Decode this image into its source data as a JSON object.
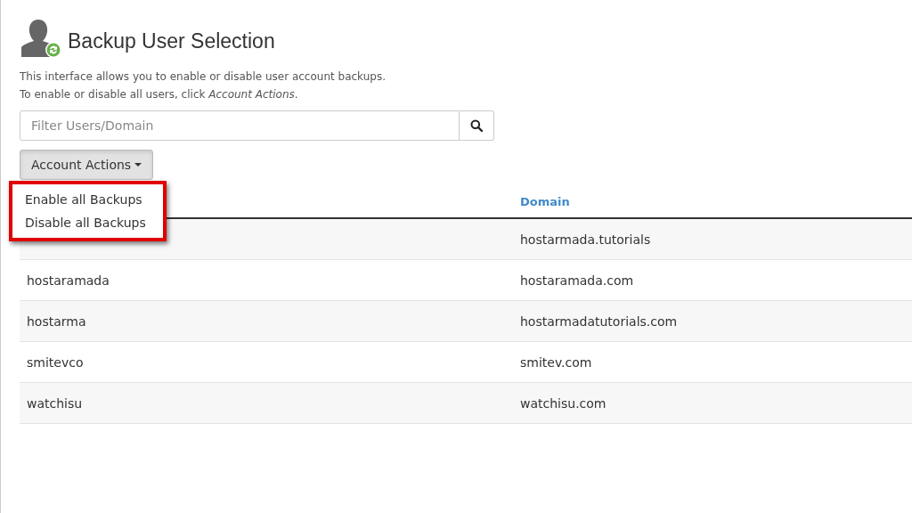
{
  "page": {
    "title": "Backup User Selection",
    "description": [
      "This interface allows you to enable or disable user account backups.",
      "To enable or disable all users, click *Account Actions*."
    ]
  },
  "filter": {
    "placeholder": "Filter Users/Domain"
  },
  "actions_button": {
    "label": "Account Actions",
    "expanded": true
  },
  "actions_menu": {
    "highlighted": true,
    "items": [
      "Enable all Backups",
      "Disable all Backups"
    ]
  },
  "table": {
    "columns": [
      "Domain"
    ],
    "rows": [
      {
        "domain": "hostarmada.tutorials"
      },
      {
        "user": "hostaramada",
        "domain": "hostaramada.com"
      },
      {
        "user": "hostarma",
        "domain": "hostarmadatutorials.com"
      },
      {
        "user": "smitevco",
        "domain": "smitev.com"
      },
      {
        "user": "watchisu",
        "domain": "watchisu.com"
      }
    ]
  }
}
